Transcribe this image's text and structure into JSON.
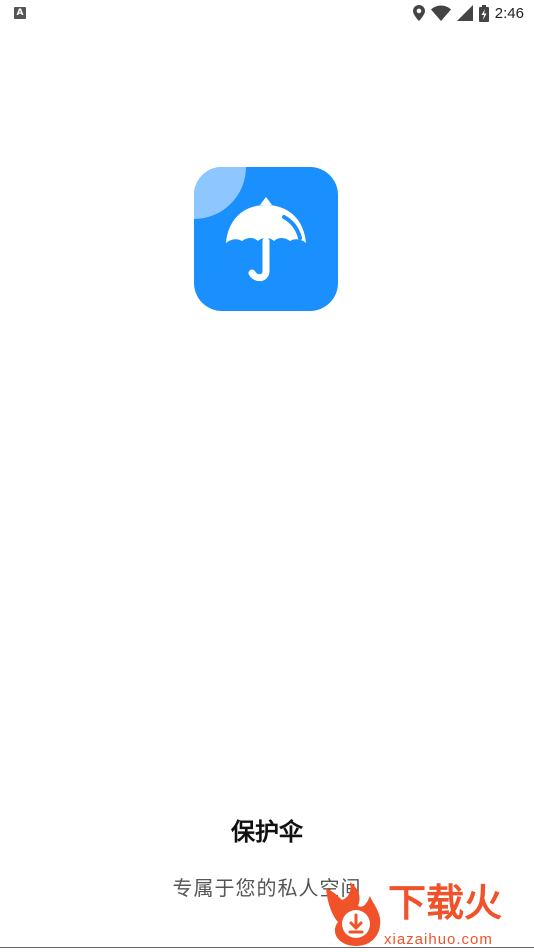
{
  "status_bar": {
    "notification_badge": "A",
    "time": "2:46",
    "icons": [
      "location-icon",
      "wifi-icon",
      "signal-icon",
      "battery-icon"
    ]
  },
  "app": {
    "name": "保护伞",
    "slogan": "专属于您的私人空间",
    "brand_color": "#1a90ff"
  },
  "watermark": {
    "text": "下载火",
    "url": "xiazaihuo.com",
    "color": "#f0522a"
  }
}
